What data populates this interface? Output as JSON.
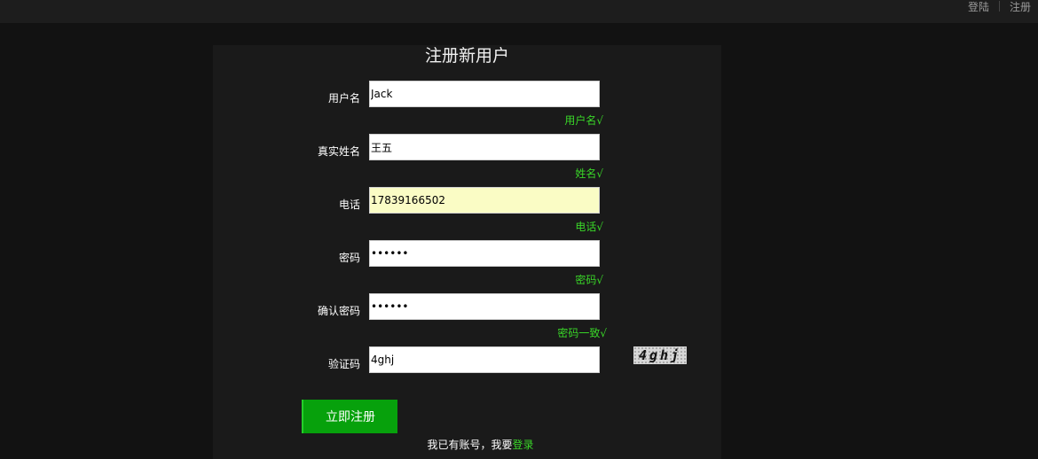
{
  "topbar": {
    "login_label": "登陆",
    "register_label": "注册"
  },
  "form": {
    "title": "注册新用户",
    "fields": [
      {
        "label": "用户名",
        "value": "Jack",
        "hint": "用户名√"
      },
      {
        "label": "真实姓名",
        "value": "王五",
        "hint": "姓名√"
      },
      {
        "label": "电话",
        "value": "17839166502",
        "hint": "电话√"
      },
      {
        "label": "密码",
        "value": "••••••",
        "hint": "密码√"
      },
      {
        "label": "确认密码",
        "value": "••••••",
        "hint": "密码一致√"
      },
      {
        "label": "验证码",
        "value": "4ghj"
      }
    ],
    "captcha_text": "4ghj",
    "submit_label": "立即注册",
    "footer_text": "我已有账号，我要",
    "footer_link": "登录"
  },
  "colors": {
    "page_background": "#121212",
    "topbar_background": "#1d1d1d",
    "panel_background": "#1a1a1a",
    "accent_green": "#07a10c",
    "hint_green": "#39d628",
    "highlight_field": "#fafcc5"
  }
}
